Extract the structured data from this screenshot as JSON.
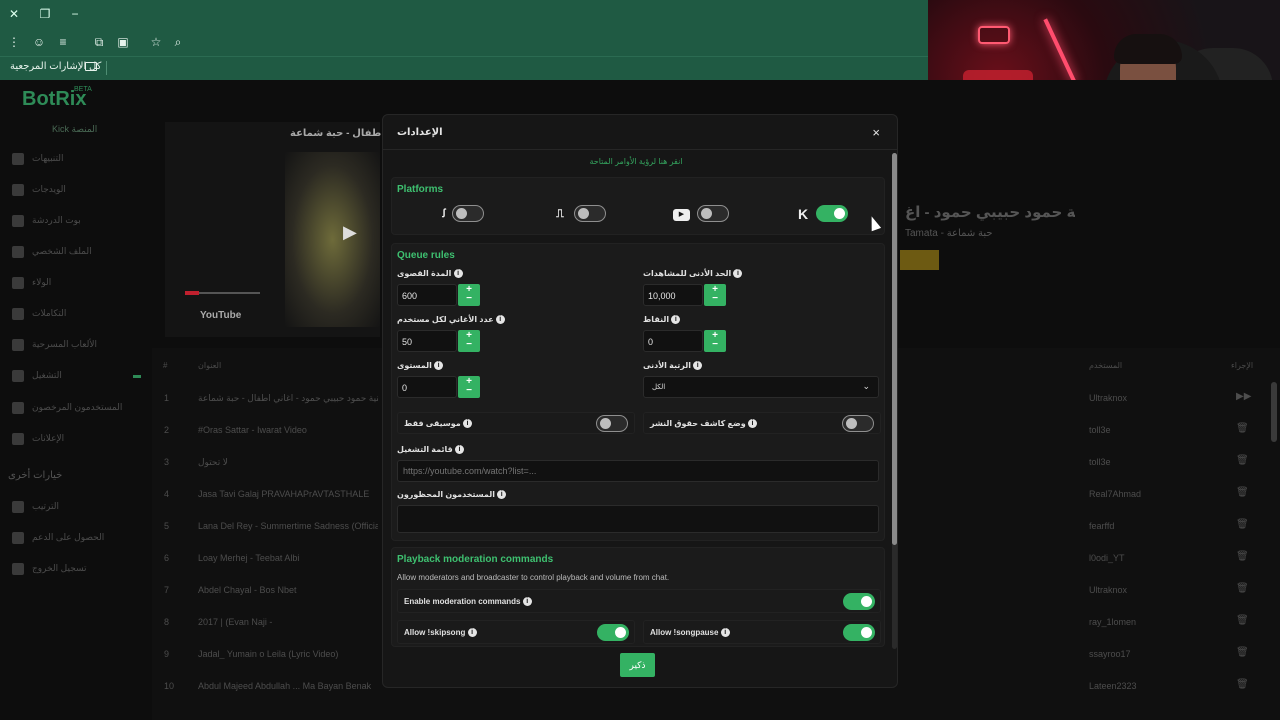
{
  "browser": {
    "bookmarks_bar_label": "كل الإشارات المرجعية"
  },
  "app": {
    "logo": "BotRix",
    "logo_badge": "BETA",
    "platform_label": "Kick المنصة",
    "sidebar": [
      {
        "label": "التنبيهات",
        "icon": "alert-icon"
      },
      {
        "label": "الويدجات",
        "icon": "widgets-icon"
      },
      {
        "label": "بوت الدردشة",
        "icon": "chat-bot-icon"
      },
      {
        "label": "الملف الشخصي",
        "icon": "profile-icon"
      },
      {
        "label": "الولاء",
        "icon": "trophy-icon"
      },
      {
        "label": "التكاملات",
        "icon": "integrations-icon"
      },
      {
        "label": "الألعاب المسرحية",
        "icon": "games-icon"
      },
      {
        "label": "التشغيل",
        "icon": "music-icon"
      },
      {
        "label": "المستخدمون المرخصون",
        "icon": "users-icon"
      },
      {
        "label": "الإعلانات",
        "icon": "ads-icon"
      }
    ],
    "sidebar_other_title": "خيارات أخرى",
    "sidebar_other": [
      {
        "label": "الترتيب",
        "icon": "ranking-icon"
      },
      {
        "label": "الحصول على الدعم",
        "icon": "help-icon"
      },
      {
        "label": "تسجيل الخروج",
        "icon": "logout-icon"
      }
    ],
    "player_title": "أغاني أطفال - حبة شماعة",
    "player_brand": "YouTube",
    "now_playing_title": "اغنية حمود حبيبي حمود - اغ",
    "now_playing_sub": "Tamata - حبة شماعة",
    "table_headers": {
      "num": "#",
      "title": "العنوان",
      "user": "المستخدم",
      "action": "الإجراء"
    },
    "rows": [
      {
        "n": "1",
        "title": "اغنية حمود حبيبي حمود - اغاني اطفال - حبة شماعة",
        "user": "Ultraknox",
        "action": "▶▶"
      },
      {
        "n": "2",
        "title": "#Oras Sattar - Iwarat Video",
        "user": "toll3e",
        "action": "🗑"
      },
      {
        "n": "3",
        "title": "لا تحتول",
        "user": "toll3e",
        "action": "🗑"
      },
      {
        "n": "4",
        "title": "Jasa Tavi Galaj PRAVAHAPrAVTASTHALE",
        "user": "Real7Ahmad",
        "action": "🗑"
      },
      {
        "n": "5",
        "title": "Lana Del Rey - Summertime Sadness (Official",
        "user": "fearffd",
        "action": "🗑"
      },
      {
        "n": "6",
        "title": "Loay Merhej - Teebat Albi",
        "user": "l0odi_YT",
        "action": "🗑"
      },
      {
        "n": "7",
        "title": "Abdel Chayal - Bos Nbet",
        "user": "Ultraknox",
        "action": "🗑"
      },
      {
        "n": "8",
        "title": "2017 | (Evan Naji -",
        "user": "ray_1lomen",
        "action": "🗑"
      },
      {
        "n": "9",
        "title": "Jadal_ Yumain o Leila (Lyric Video)",
        "user": "ssayroo17",
        "action": "🗑"
      },
      {
        "n": "10",
        "title": "Abdul Majeed Abdullah ... Ma Bayan Benak",
        "user": "Lateen2323",
        "action": "🗑"
      }
    ]
  },
  "modal": {
    "title": "الإعدادات",
    "close": "×",
    "commands_link": "انقر هنا لرؤية الأوامر المتاحة",
    "platforms": {
      "title": "Platforms",
      "items": [
        {
          "name": "kick",
          "icon": "kick-icon",
          "glyph": "K",
          "enabled": true
        },
        {
          "name": "youtube",
          "icon": "youtube-icon",
          "glyph": "▶",
          "enabled": false
        },
        {
          "name": "twitch",
          "icon": "twitch-icon",
          "glyph": "⎍",
          "enabled": false
        },
        {
          "name": "trovo",
          "icon": "trovo-icon",
          "glyph": "ꭍ",
          "enabled": false
        }
      ]
    },
    "queue": {
      "title": "Queue rules",
      "min_views_label": "الحد الأدنى للمشاهدات",
      "min_views_value": "10,000",
      "max_duration_label": "المدة القصوى",
      "max_duration_value": "600",
      "points_label": "النقاط",
      "points_value": "0",
      "songs_per_user_label": "عدد الأغاني لكل مستخدم",
      "songs_per_user_value": "50",
      "min_rank_label": "الرتبة الأدنى",
      "min_rank_value": "الكل",
      "level_label": "المستوى",
      "level_value": "0",
      "copyright_label": "وضع كاشف حقوق النشر",
      "copyright_enabled": false,
      "music_only_label": "موسيقى فقط",
      "music_only_enabled": false,
      "playlist_label": "قائمة التشغيل",
      "playlist_placeholder": "https://youtube.com/watch?list=...",
      "banned_users_label": "المستخدمون المحظورون"
    },
    "playback": {
      "title": "Playback moderation commands",
      "description": "Allow moderators and broadcaster to control playback and volume from chat.",
      "enable_label": "Enable moderation commands",
      "enable_on": true,
      "skip_label": "Allow !skipsong",
      "skip_on": true,
      "pause_label": "Allow !songpause",
      "pause_on": true
    },
    "save_label": "ذكير"
  },
  "colors": {
    "accent": "#34b263",
    "browser_chrome": "#1f5a43",
    "modal_bg": "#161616"
  }
}
